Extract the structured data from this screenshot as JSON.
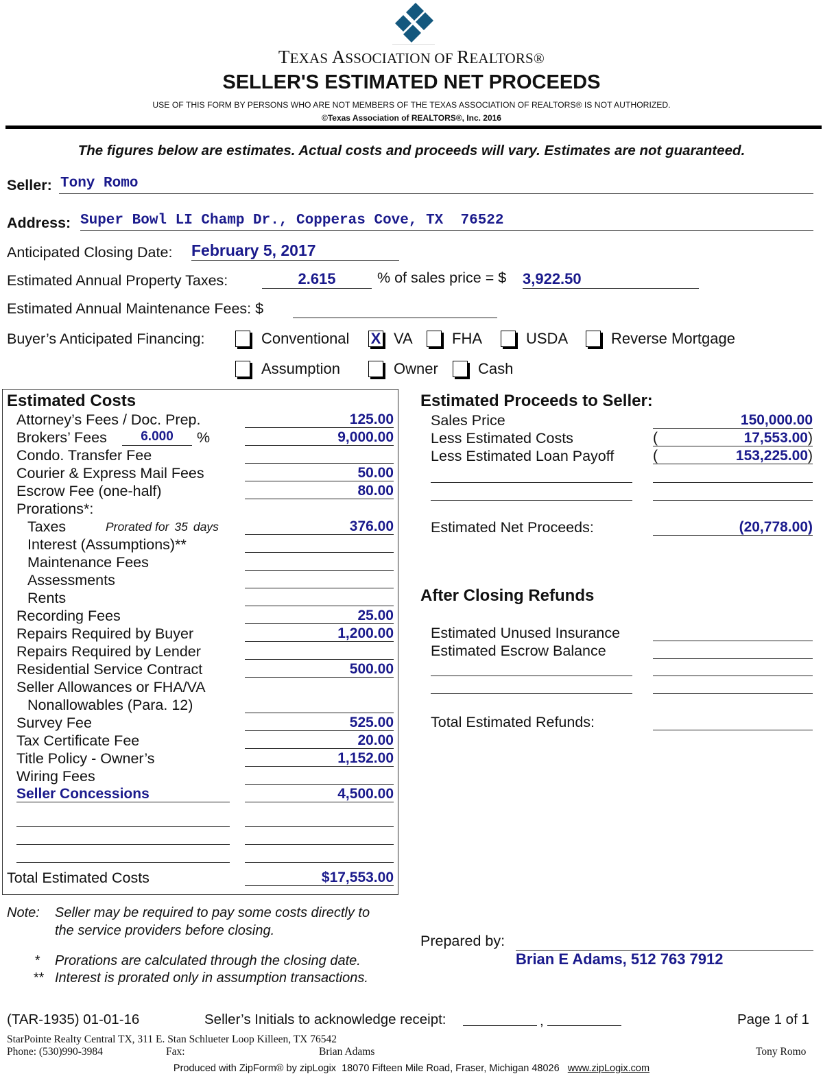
{
  "header": {
    "logo_icon": "tar-diamond-logo",
    "org_name_parts": [
      "T",
      "EXAS ",
      "A",
      "SSOCIATION OF ",
      "R",
      "EALTORS®"
    ],
    "title": "SELLER'S ESTIMATED NET PROCEEDS",
    "notice": "USE OF THIS FORM BY PERSONS WHO ARE NOT MEMBERS OF THE TEXAS ASSOCIATION OF REALTORS® IS NOT AUTHORIZED.",
    "copyright": "©Texas Association of REALTORS®, Inc. 2016"
  },
  "disclaimer": "The figures below are estimates. Actual costs and proceeds will vary. Estimates are not guaranteed.",
  "seller": {
    "label": "Seller:",
    "value": "Tony Romo"
  },
  "address": {
    "label": "Address:",
    "value": "Super Bowl LI Champ Dr., Copperas Cove, TX  76522"
  },
  "closing_date": {
    "label": "Anticipated Closing Date:",
    "value": "February 5, 2017"
  },
  "property_taxes": {
    "label": "Estimated Annual Property Taxes:",
    "percent": "2.615",
    "mid_label": "% of sales price = $",
    "amount": "3,922.50"
  },
  "maintenance_fees": {
    "label": "Estimated Annual Maintenance Fees: $",
    "value": ""
  },
  "financing": {
    "label": "Buyer’s Anticipated Financing:",
    "options": [
      {
        "label": "Conventional",
        "checked": false,
        "mark": ""
      },
      {
        "label": "VA",
        "checked": true,
        "mark": "X"
      },
      {
        "label": "FHA",
        "checked": false,
        "mark": ""
      },
      {
        "label": "USDA",
        "checked": false,
        "mark": ""
      },
      {
        "label": "Reverse Mortgage",
        "checked": false,
        "mark": ""
      },
      {
        "label": "Assumption",
        "checked": false,
        "mark": ""
      },
      {
        "label": "Owner",
        "checked": false,
        "mark": ""
      },
      {
        "label": "Cash",
        "checked": false,
        "mark": ""
      }
    ]
  },
  "costs": {
    "heading": "Estimated Costs",
    "items": [
      {
        "label": "Attorney’s Fees / Doc. Prep.",
        "value": "125.00"
      },
      {
        "label": "Brokers’ Fees",
        "percent": "6.000",
        "percent_sign": "%",
        "value": "9,000.00"
      },
      {
        "label": "Condo. Transfer Fee",
        "value": ""
      },
      {
        "label": "Courier & Express Mail Fees",
        "value": "50.00"
      },
      {
        "label": "Escrow Fee (one-half)",
        "value": "80.00"
      },
      {
        "label": "Prorations*:",
        "value": null
      },
      {
        "label": "Taxes",
        "note_prefix": "Prorated for",
        "days": "35",
        "note_suffix": "days",
        "value": "376.00"
      },
      {
        "label": "Interest (Assumptions)**",
        "value": ""
      },
      {
        "label": "Maintenance Fees",
        "value": ""
      },
      {
        "label": "Assessments",
        "value": ""
      },
      {
        "label": "Rents",
        "value": ""
      },
      {
        "label": "Recording Fees",
        "value": "25.00"
      },
      {
        "label": "Repairs Required by Buyer",
        "value": "1,200.00"
      },
      {
        "label": "Repairs Required by Lender",
        "value": ""
      },
      {
        "label": "Residential Service Contract",
        "value": "500.00"
      },
      {
        "label": "Seller Allowances or FHA/VA",
        "value": null
      },
      {
        "label": "Nonallowables (Para. 12)",
        "value": ""
      },
      {
        "label": "Survey Fee",
        "value": "525.00"
      },
      {
        "label": "Tax Certificate Fee",
        "value": "20.00"
      },
      {
        "label": "Title Policy - Owner’s",
        "value": "1,152.00"
      },
      {
        "label": "Wiring Fees",
        "value": ""
      },
      {
        "label": "Seller Concessions",
        "value": "4,500.00",
        "custom": true
      },
      {
        "label": "",
        "value": "",
        "custom": true
      },
      {
        "label": "",
        "value": "",
        "custom": true
      },
      {
        "label": "",
        "value": "",
        "custom": true
      }
    ],
    "total_label": "Total Estimated Costs",
    "total_value": "$17,553.00"
  },
  "proceeds": {
    "heading": "Estimated Proceeds to Seller:",
    "sales_price": {
      "label": "Sales Price",
      "value": "150,000.00"
    },
    "less_costs": {
      "label": "Less Estimated Costs",
      "value": "17,553.00"
    },
    "less_loan": {
      "label": "Less Estimated Loan Payoff",
      "value": "153,225.00"
    },
    "net": {
      "label": "Estimated Net Proceeds:",
      "value": "(20,778.00)"
    }
  },
  "refunds": {
    "heading": "After Closing Refunds",
    "unused_insurance": {
      "label": "Estimated Unused Insurance",
      "value": ""
    },
    "escrow_balance": {
      "label": "Estimated Escrow Balance",
      "value": ""
    },
    "total": {
      "label": "Total Estimated Refunds:",
      "value": ""
    }
  },
  "notes": {
    "note_label": "Note:",
    "note_line1": "Seller may be required to pay some costs directly to",
    "note_line2": "the service providers before closing.",
    "star1": "*",
    "star1_text": "Prorations are calculated through the closing date.",
    "star2": "**",
    "star2_text": "Interest is prorated only in assumption transactions."
  },
  "prepared_by": {
    "label": "Prepared by:",
    "value": "Brian E Adams, 512 763 7912"
  },
  "footer": {
    "form_id": "(TAR-1935) 01-01-16",
    "initials_label": "Seller’s Initials to acknowledge receipt:",
    "initials_sep": ",",
    "page": "Page 1 of 1",
    "broker_line": "StarPointe Realty Central TX, 311 E. Stan Schlueter Loop Killeen, TX 76542",
    "phone": "Phone: (530)990-3984",
    "fax": "Fax:",
    "agent": "Brian Adams",
    "client": "Tony Romo",
    "produced": "Produced with ZipForm® by zipLogix  18070 Fifteen Mile Road, Fraser, Michigan 48026",
    "produced_link": "www.zipLogix.com"
  }
}
